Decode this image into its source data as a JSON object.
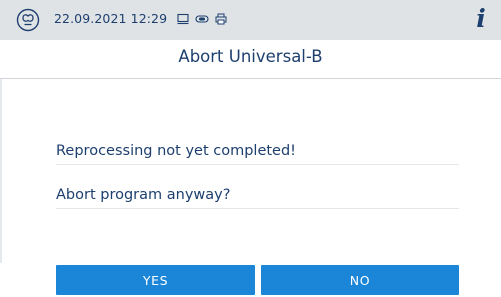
{
  "header": {
    "datetime": "22.09.2021 12:29",
    "device_logo_icon": "instrument-logo-icon",
    "status_icons": [
      "monitor-icon",
      "link-icon",
      "printer-icon"
    ],
    "info_label": "i"
  },
  "dialog": {
    "title": "Abort Universal-B",
    "message_line_1": "Reprocessing not yet completed!",
    "message_line_2": "Abort program anyway?"
  },
  "buttons": {
    "yes_label": "YES",
    "no_label": "NO"
  },
  "colors": {
    "topbar_bg": "#dfe3e6",
    "text": "#1d3f6e",
    "button_bg": "#1b85d8",
    "button_text": "#ffffff"
  }
}
